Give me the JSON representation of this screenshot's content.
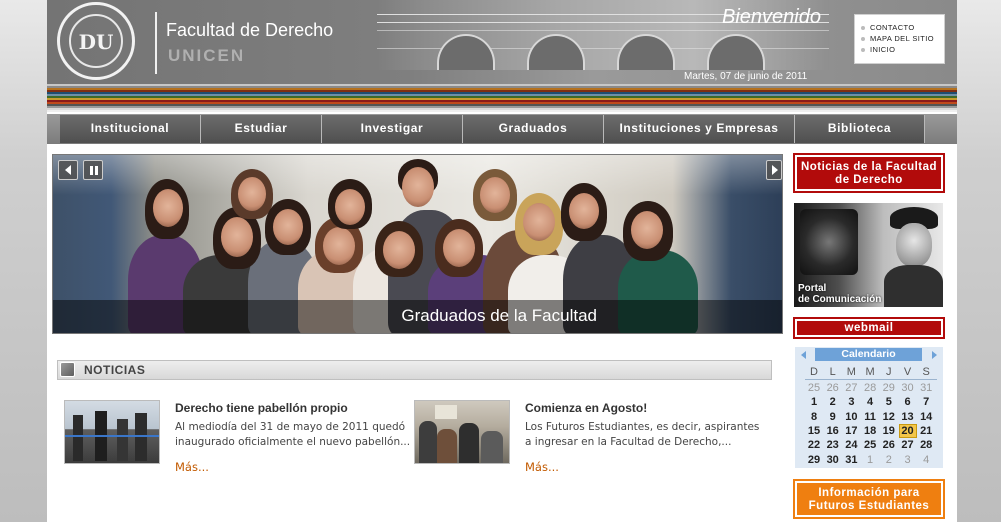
{
  "header": {
    "site_title": "Facultad de Derecho",
    "site_subtitle": "UNICEN",
    "welcome": "Bienvenido",
    "date": "Martes, 07 de junio de 2011",
    "seal_mark": "DU"
  },
  "quick_links": [
    "CONTACTO",
    "MAPA DEL SITIO",
    "INICIO"
  ],
  "nav": {
    "items": [
      "Institucional",
      "Estudiar",
      "Investigar",
      "Graduados",
      "Instituciones y Empresas",
      "Biblioteca"
    ]
  },
  "slider": {
    "caption": "Graduados de la Facultad"
  },
  "news": {
    "section_title": "NOTICIAS",
    "items": [
      {
        "title": "Derecho tiene pabellón propio",
        "body": "Al mediodía del 31 de mayo de 2011 quedó inaugurado oficialmente el nuevo pabellón...",
        "more": "Más..."
      },
      {
        "title": "Comienza en Agosto!",
        "body": "Los Futuros Estudiantes, es decir, aspirantes a ingresar en la Facultad de Derecho,...",
        "more": "Más..."
      }
    ]
  },
  "sidebar": {
    "news_button": "Noticias de la Facultad de Derecho",
    "portal_label_1": "Portal",
    "portal_label_2": "de Comunicación",
    "webmail": "webmail",
    "future_students": "Información para Futuros Estudiantes"
  },
  "calendar": {
    "title": "Calendario",
    "weekdays": [
      "D",
      "L",
      "M",
      "M",
      "J",
      "V",
      "S"
    ],
    "weeks": [
      [
        "25",
        "26",
        "27",
        "28",
        "29",
        "30",
        "31"
      ],
      [
        "1",
        "2",
        "3",
        "4",
        "5",
        "6",
        "7"
      ],
      [
        "8",
        "9",
        "10",
        "11",
        "12",
        "13",
        "14"
      ],
      [
        "15",
        "16",
        "17",
        "18",
        "19",
        "20",
        "21"
      ],
      [
        "22",
        "23",
        "24",
        "25",
        "26",
        "27",
        "28"
      ],
      [
        "29",
        "30",
        "31",
        "1",
        "2",
        "3",
        "4"
      ]
    ],
    "today": "20"
  },
  "colors": {
    "brand_red": "#b20b0b",
    "accent_orange": "#ef7f10",
    "link_more": "#c25a00",
    "calendar_header": "#6ea2d8"
  }
}
